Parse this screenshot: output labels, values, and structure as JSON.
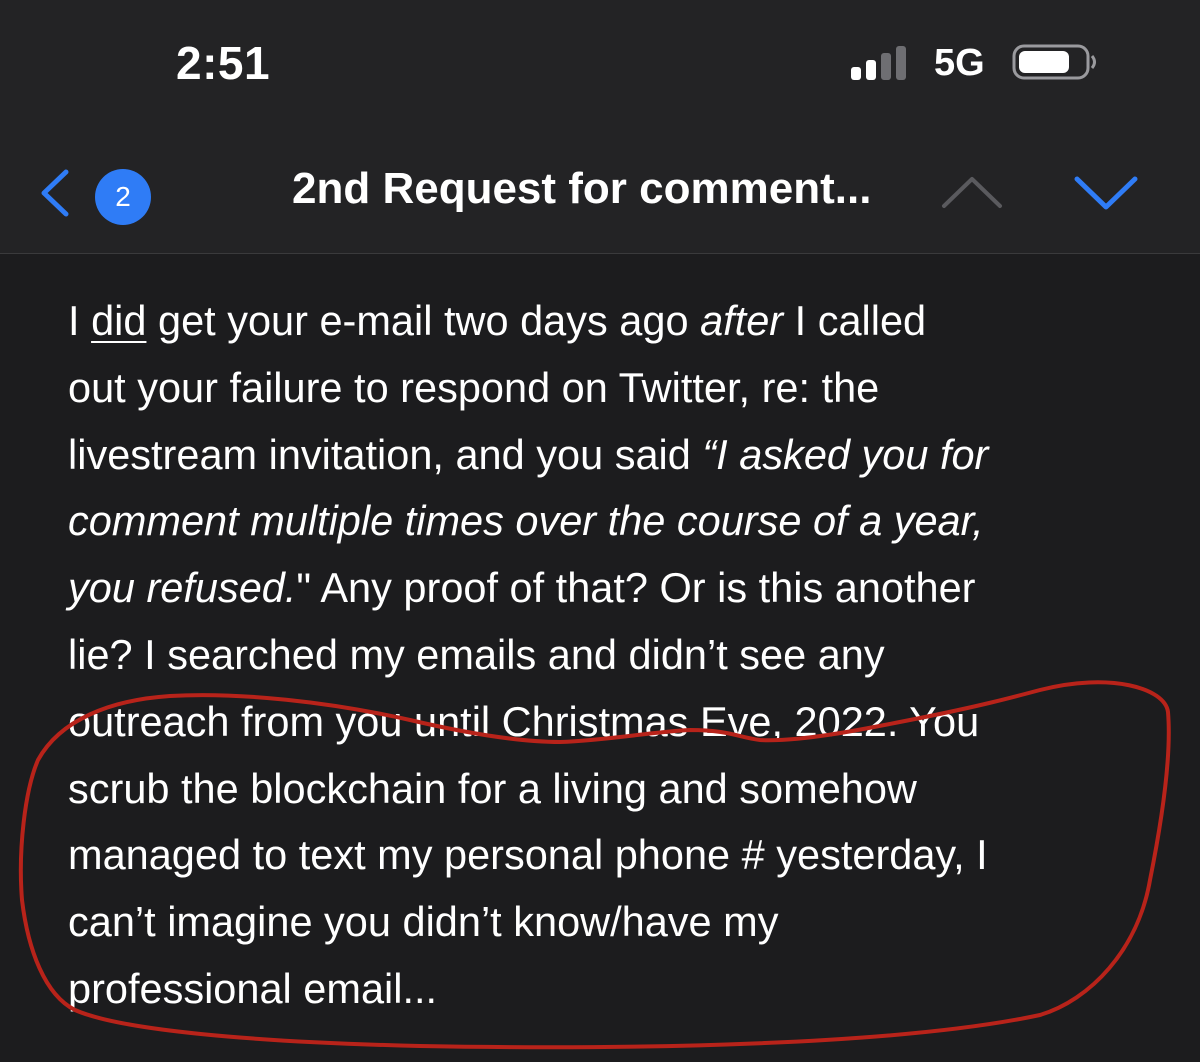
{
  "status_bar": {
    "time": "2:51",
    "network": "5G",
    "signal_icon": "cellular-signal-icon",
    "battery_icon": "battery-icon"
  },
  "nav": {
    "back_icon": "chevron-left-icon",
    "badge_count": "2",
    "title": "2nd Request for comment...",
    "prev_icon": "chevron-up-icon",
    "next_icon": "chevron-down-icon",
    "accent_color": "#2f7cf6",
    "disabled_color": "#5a5a5e"
  },
  "email_body": {
    "lines": [
      [
        {
          "t": "I ",
          "s": ""
        },
        {
          "t": "did",
          "s": "u"
        },
        {
          "t": " get your e-mail two days ago ",
          "s": ""
        },
        {
          "t": "after",
          "s": "i"
        },
        {
          "t": " I called",
          "s": ""
        }
      ],
      [
        {
          "t": "out your failure to respond on Twitter, re: the",
          "s": ""
        }
      ],
      [
        {
          "t": "livestream invitation, and you said ",
          "s": ""
        },
        {
          "t": "“I asked you for",
          "s": "i"
        }
      ],
      [
        {
          "t": "comment multiple times over the course of a year,",
          "s": "i"
        }
      ],
      [
        {
          "t": "you refused.",
          "s": "i"
        },
        {
          "t": "\" Any proof of that? Or is this another",
          "s": ""
        }
      ],
      [
        {
          "t": "lie? I searched my emails and didn’t see any",
          "s": ""
        }
      ],
      [
        {
          "t": "outreach from you until Christmas Eve, 2022. You",
          "s": ""
        }
      ],
      [
        {
          "t": "scrub the blockchain for a living and somehow",
          "s": ""
        }
      ],
      [
        {
          "t": "managed to text my personal phone # yesterday, I",
          "s": ""
        }
      ],
      [
        {
          "t": "can’t imagine you didn’t know/have my",
          "s": ""
        }
      ],
      [
        {
          "t": "professional email...",
          "s": ""
        }
      ]
    ]
  },
  "annotation": {
    "shape": "hand-drawn-circle",
    "color": "#b8231a"
  }
}
